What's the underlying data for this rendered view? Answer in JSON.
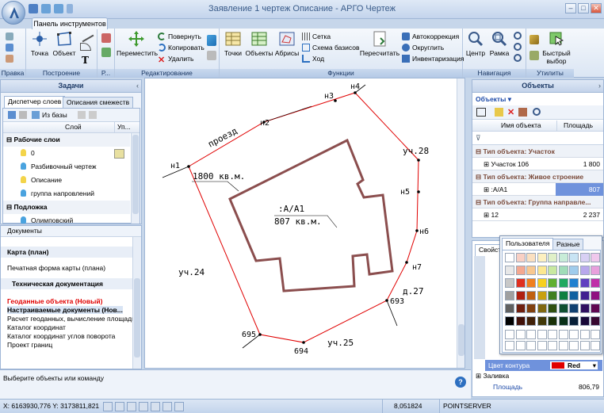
{
  "window": {
    "title": "Заявление 1 чертеж Описание - АРГО Чертеж",
    "min": "–",
    "max": "□",
    "close": "✕"
  },
  "ribbon": {
    "tab": "Панель инструментов",
    "groups": {
      "pravka": "Правка",
      "postroenie": "Построение",
      "r": "Р...",
      "redakt": "Редактирование",
      "funkcii": "Функции",
      "navigacia": "Навигация",
      "utility": "Утилиты"
    },
    "buttons": {
      "tochka": "Точка",
      "obekt": "Объект",
      "peremestit": "Переместить",
      "povernut": "Повернуть",
      "kopirovat": "Копировать",
      "udalit": "Удалить",
      "tochki": "Точки",
      "obekty": "Объекты",
      "abrisy": "Абрисы",
      "setka": "Сетка",
      "shema": "Схема базисов",
      "hod": "Ход",
      "pereschitat": "Пересчитать",
      "avtokorr": "Автокоррекция",
      "okruglit": "Округлить",
      "inventar": "Инвентаризация",
      "centr": "Центр",
      "ramka": "Рамка",
      "bystry1": "Быстрый",
      "bystry2": "выбор"
    }
  },
  "tasks": {
    "title": "Задачи",
    "tabs": [
      "Диспетчер слоев",
      "Описания смежеств"
    ],
    "from_base": "Из базы",
    "col_layer": "Слой",
    "col_up": "Уп...",
    "group_work": "Рабочие слои",
    "layers": [
      "0",
      "Разбивочный чертеж",
      "Описание",
      "группа напровлений"
    ],
    "group_bg": "Подложка",
    "bg_layers": [
      "Олимповский"
    ]
  },
  "documents": {
    "title": "Документы",
    "sec_map": "Карта (план)",
    "print_map": "Печатная форма карты (плана)",
    "sec_tech": "Техническая документация",
    "items": [
      "Геоданные объекта (Новый)",
      "Настраиваемые документы (Нов...",
      "Расчет геоданных, вычисление площади",
      "Каталог координат",
      "Каталог координат углов поворота",
      "Проект границ"
    ]
  },
  "drawing": {
    "road": "проезд",
    "area1": "1800 кв.м.",
    "building": ":А/А1",
    "area2": "807 кв.м.",
    "neighbors": [
      "уч.28",
      "уч.24",
      "уч.25",
      "д.27"
    ],
    "points": [
      "н1",
      "н2",
      "н3",
      "н4",
      "н5",
      "н6",
      "н7",
      "693",
      "694",
      "695"
    ]
  },
  "objects": {
    "title": "Объекты",
    "dropdown": "Объекты",
    "col_name": "Имя объекта",
    "col_area": "Площадь",
    "groups": [
      {
        "title": "Тип объекта: Участок",
        "name": "Участок 106",
        "area": "1 800"
      },
      {
        "title": "Тип объекта: Живое строение",
        "name": ":А/А1",
        "area": "807"
      },
      {
        "title": "Тип объекта: Группа направле...",
        "name": "12",
        "area": "2 237"
      }
    ]
  },
  "props": {
    "tab": "Свойст...",
    "color_label": "Цвет контура",
    "color_value": "Red",
    "fill": "Заливка",
    "area_label": "Площадь",
    "area_value": "806,79"
  },
  "palette": {
    "tabs": [
      "Пользователя",
      "Разные"
    ]
  },
  "status": {
    "hint": "Выберите объекты или команду",
    "coords": "X: 6163930,776 Y: 3173811,821",
    "scale": "8,051824",
    "server": "POINTSERVER"
  },
  "colors": {
    "accent": "#c6d6ea",
    "contour": "#e00000",
    "building": "#8b4e4e"
  }
}
